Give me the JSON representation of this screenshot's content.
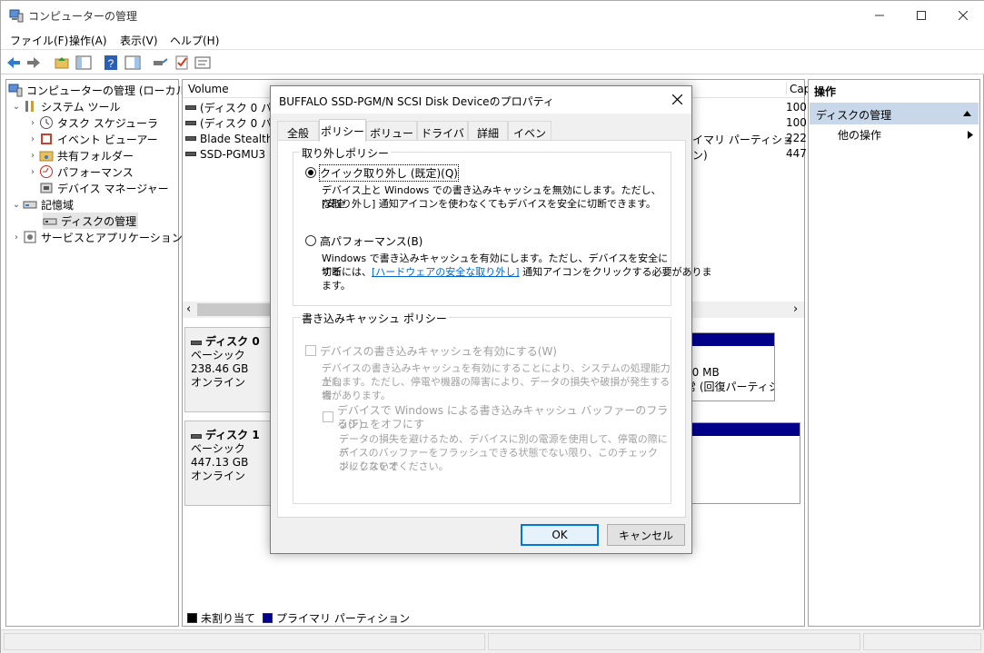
{
  "window": {
    "title": "コンピューターの管理",
    "controls": [
      "minimize-icon",
      "maximize-icon",
      "close-icon"
    ]
  },
  "menu": [
    {
      "label": "ファイル(F)"
    },
    {
      "label": "操作(A)"
    },
    {
      "label": "表示(V)"
    },
    {
      "label": "ヘルプ(H)"
    }
  ],
  "toolbar": {
    "icons": [
      "back-arrow-icon",
      "forward-arrow-icon",
      "up-folder-icon",
      "show-hide-tree-icon",
      "help-icon",
      "action-pane-icon",
      "connect-icon",
      "check-icon",
      "properties-icon"
    ]
  },
  "tree": {
    "root": "コンピューターの管理 (ローカル)",
    "items": [
      {
        "label": "システム ツール"
      },
      {
        "label": "タスク スケジューラ"
      },
      {
        "label": "イベント ビューアー"
      },
      {
        "label": "共有フォルダー"
      },
      {
        "label": "パフォーマンス"
      },
      {
        "label": "デバイス マネージャー"
      },
      {
        "label": "記憶域"
      },
      {
        "label": "ディスクの管理"
      },
      {
        "label": "サービスとアプリケーション"
      }
    ]
  },
  "volumes": {
    "headers": {
      "volume": "Volume",
      "cap": "Cap"
    },
    "rows": [
      {
        "name": "(ディスク 0 パーテ",
        "cap": "100"
      },
      {
        "name": "(ディスク 0 パーテ",
        "cap": "100"
      },
      {
        "name": "Blade Stealth (",
        "type_fragment": "イマリ パーティション)",
        "cap": "222"
      },
      {
        "name": "SSD-PGMU3 (T",
        "cap": "447"
      }
    ]
  },
  "disks": [
    {
      "name": "ディスク 0",
      "type": "ベーシック",
      "size": "238.46 GB",
      "status": "オンライン",
      "part_fragment_1": "00 MB",
      "part_fragment_2": "常 (回復パーティシ"
    },
    {
      "name": "ディスク 1",
      "type": "ベーシック",
      "size": "447.13 GB",
      "status": "オンライン"
    }
  ],
  "legend": {
    "unallocated": "未割り当て",
    "primary": "プライマリ パーティション",
    "colors": {
      "unallocated": "#000000",
      "primary": "#00008b"
    }
  },
  "actions": {
    "header": "操作",
    "selected": "ディスクの管理",
    "item": "他の操作"
  },
  "dialog": {
    "title": "BUFFALO SSD-PGM/N SCSI Disk Deviceのプロパティ",
    "tabs": [
      "全般",
      "ポリシー",
      "ボリューム",
      "ドライバー",
      "詳細",
      "イベント"
    ],
    "active_tab": "ポリシー",
    "removal_group": "取り外しポリシー",
    "quick": {
      "label": "クイック取り外し (既定)(Q)",
      "desc1": "デバイス上と Windows での書き込みキャッシュを無効にします。ただし、[安全",
      "desc2": "な取り外し] 通知アイコンを使わなくてもデバイスを安全に切断できます。"
    },
    "perf": {
      "label": "高パフォーマンス(B)",
      "desc1": "Windows で書き込みキャッシュを有効にします。ただし、デバイスを安全に切断",
      "desc2_a": "するには、",
      "desc2_link": "[ハードウェアの安全な取り外し]",
      "desc2_b": " 通知アイコンをクリックする必要がありま",
      "desc3": "ます。"
    },
    "cache_group": "書き込みキャッシュ ポリシー",
    "cache_enable": {
      "label": "デバイスの書き込みキャッシュを有効にする(W)",
      "desc1": "デバイスの書き込みキャッシュを有効にすることにより、システムの処理能力が向",
      "desc2": "上します。ただし、停電や機器の障害により、データの損失や破損が発生する場",
      "desc3": "合があります。"
    },
    "flush": {
      "label1": "デバイスで Windows による書き込みキャッシュ バッファーのフラッシュをオフにす",
      "label2": "る(F)",
      "desc1": "データの損失を避けるため、デバイスに別の電源を使用して、停電の際にデ",
      "desc2": "バイスのバッファーをフラッシュできる状態でない限り、このチェック ボックスをオ",
      "desc3": "ンにしないでください。"
    },
    "ok": "OK",
    "cancel": "キャンセル"
  }
}
